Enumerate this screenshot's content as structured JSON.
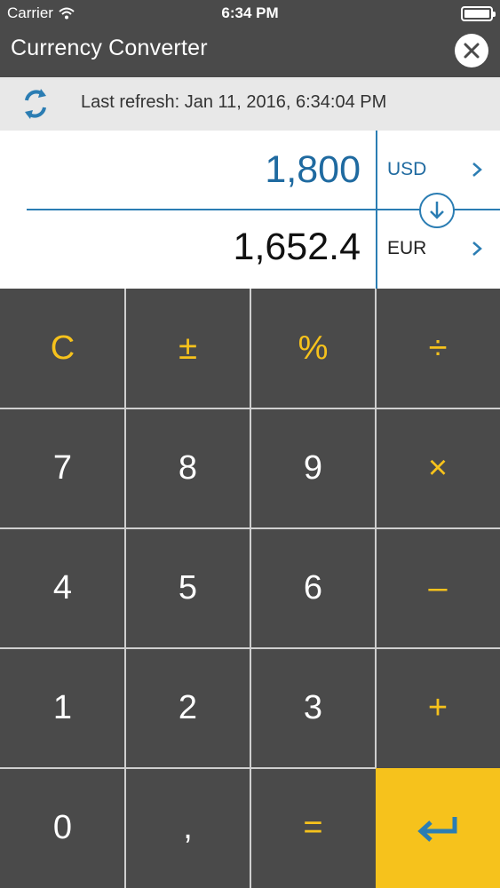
{
  "status_bar": {
    "carrier": "Carrier",
    "time": "6:34 PM"
  },
  "header": {
    "title": "Currency Converter",
    "close_icon": "close-icon"
  },
  "refresh": {
    "icon": "refresh-icon",
    "text": "Last refresh: Jan 11, 2016, 6:34:04 PM"
  },
  "converter": {
    "from": {
      "amount": "1,800",
      "currency": "USD"
    },
    "to": {
      "amount": "1,652.4",
      "currency": "EUR"
    },
    "swap_icon": "arrow-down-circle-icon"
  },
  "keypad": {
    "keys": [
      {
        "label": "C",
        "name": "clear-key",
        "type": "op"
      },
      {
        "label": "±",
        "name": "plus-minus-key",
        "type": "op"
      },
      {
        "label": "%",
        "name": "percent-key",
        "type": "op"
      },
      {
        "label": "÷",
        "name": "divide-key",
        "type": "op"
      },
      {
        "label": "7",
        "name": "digit-7-key",
        "type": "digit"
      },
      {
        "label": "8",
        "name": "digit-8-key",
        "type": "digit"
      },
      {
        "label": "9",
        "name": "digit-9-key",
        "type": "digit"
      },
      {
        "label": "×",
        "name": "multiply-key",
        "type": "op"
      },
      {
        "label": "4",
        "name": "digit-4-key",
        "type": "digit"
      },
      {
        "label": "5",
        "name": "digit-5-key",
        "type": "digit"
      },
      {
        "label": "6",
        "name": "digit-6-key",
        "type": "digit"
      },
      {
        "label": "–",
        "name": "minus-key",
        "type": "op"
      },
      {
        "label": "1",
        "name": "digit-1-key",
        "type": "digit"
      },
      {
        "label": "2",
        "name": "digit-2-key",
        "type": "digit"
      },
      {
        "label": "3",
        "name": "digit-3-key",
        "type": "digit"
      },
      {
        "label": "+",
        "name": "plus-key",
        "type": "op"
      },
      {
        "label": "0",
        "name": "digit-0-key",
        "type": "digit"
      },
      {
        "label": ",",
        "name": "decimal-key",
        "type": "digit"
      },
      {
        "label": "=",
        "name": "equals-key",
        "type": "op"
      },
      {
        "label": "",
        "name": "enter-key",
        "type": "enter"
      }
    ]
  },
  "colors": {
    "accent": "#f6c21c",
    "blue": "#2b7db3",
    "background": "#4a4a4a"
  }
}
